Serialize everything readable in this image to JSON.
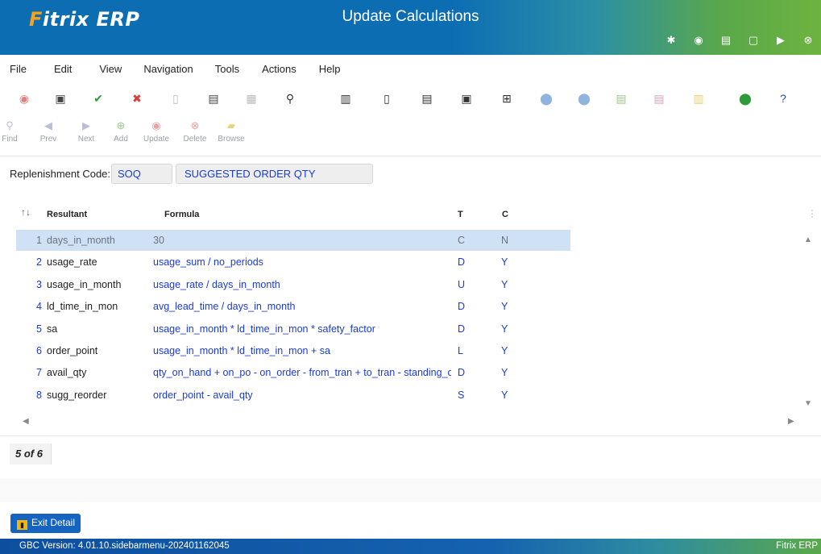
{
  "header": {
    "logo_f": "F",
    "logo_rest": "itrix ERP",
    "title": "Update Calculations",
    "icons": [
      "gear-icon",
      "target-icon",
      "document-icon",
      "new-page-icon",
      "play-icon",
      "close-icon"
    ]
  },
  "menu": [
    "File",
    "Edit",
    "View",
    "Navigation",
    "Tools",
    "Actions",
    "Help"
  ],
  "nav_buttons": [
    {
      "label": "Find",
      "icon": "find-icon"
    },
    {
      "label": "Prev",
      "icon": "prev-icon"
    },
    {
      "label": "Next",
      "icon": "next-icon"
    },
    {
      "label": "Add",
      "icon": "add-icon"
    },
    {
      "label": "Update",
      "icon": "update-icon"
    },
    {
      "label": "Delete",
      "icon": "delete-icon"
    },
    {
      "label": "Browse",
      "icon": "browse-icon"
    }
  ],
  "replenishment": {
    "label": "Replenishment Code:",
    "code": "SOQ",
    "description": "SUGGESTED ORDER QTY"
  },
  "table": {
    "sort_icon": "↑↓",
    "headers": {
      "resultant": "Resultant",
      "formula": "Formula",
      "t": "T",
      "c": "C"
    },
    "rows": [
      {
        "num": "1",
        "resultant": "days_in_month",
        "formula": "30",
        "t": "C",
        "c": "N"
      },
      {
        "num": "2",
        "resultant": "usage_rate",
        "formula": "usage_sum / no_periods",
        "t": "D",
        "c": "Y"
      },
      {
        "num": "3",
        "resultant": "usage_in_month",
        "formula": "usage_rate / days_in_month",
        "t": "U",
        "c": "Y"
      },
      {
        "num": "4",
        "resultant": "ld_time_in_mon",
        "formula": "avg_lead_time / days_in_month",
        "t": "D",
        "c": "Y"
      },
      {
        "num": "5",
        "resultant": "sa",
        "formula": "usage_in_month * ld_time_in_mon * safety_factor",
        "t": "D",
        "c": "Y"
      },
      {
        "num": "6",
        "resultant": "order_point",
        "formula": "usage_in_month * ld_time_in_mon + sa",
        "t": "L",
        "c": "Y"
      },
      {
        "num": "7",
        "resultant": "avail_qty",
        "formula": "qty_on_hand + on_po - on_order - from_tran + to_tran - standing_o",
        "t": "D",
        "c": "Y"
      },
      {
        "num": "8",
        "resultant": "sugg_reorder",
        "formula": "order_point - avail_qty",
        "t": "S",
        "c": "Y"
      }
    ]
  },
  "record_count": "5 of 6",
  "exit_button": "Exit Detail",
  "status": {
    "version": "GBC Version: 4.01.10.sidebarmenu-202401162045",
    "brand": "Fitrix ERP"
  },
  "colors": {
    "accent": "#0c6db3",
    "value_blue": "#1a3bd6",
    "selected_row": "#cfe2f5"
  }
}
